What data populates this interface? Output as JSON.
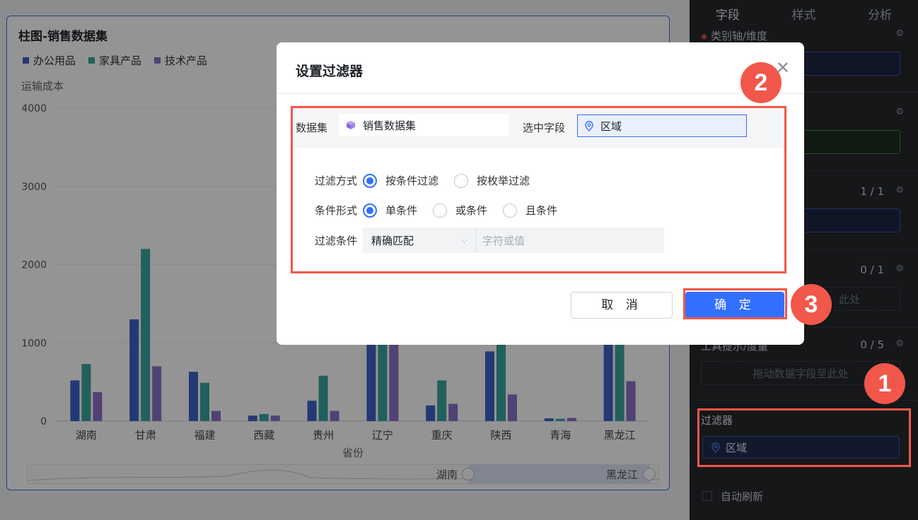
{
  "chart_card": {
    "title": "柱图-销售数据集",
    "y_axis_label": "运输成本",
    "x_axis_label": "省份",
    "slider_start_label": "湖南",
    "slider_end_label": "黑龙江"
  },
  "chart_data": {
    "type": "bar",
    "title": "柱图-销售数据集",
    "xlabel": "省份",
    "ylabel": "运输成本",
    "ylim": [
      0,
      4000
    ],
    "yticks": [
      0,
      1000,
      2000,
      3000,
      4000
    ],
    "categories": [
      "湖南",
      "甘肃",
      "福建",
      "西藏",
      "贵州",
      "辽宁",
      "重庆",
      "陕西",
      "青海",
      "黑龙江"
    ],
    "series": [
      {
        "name": "办公用品",
        "color": "#3e63c8",
        "values": [
          520,
          1300,
          630,
          70,
          260,
          1000,
          200,
          890,
          35,
          1000
        ]
      },
      {
        "name": "家具产品",
        "color": "#3aa6a0",
        "values": [
          730,
          2200,
          490,
          90,
          580,
          1000,
          520,
          1000,
          30,
          1000
        ]
      },
      {
        "name": "技术产品",
        "color": "#8a72c9",
        "values": [
          370,
          700,
          130,
          70,
          130,
          1000,
          220,
          340,
          40,
          510
        ]
      }
    ],
    "legend_position": "top-left",
    "grid": true
  },
  "panel": {
    "tabs": [
      "字段",
      "样式",
      "分析"
    ],
    "active_tab": "字段",
    "category_axis_label": "类别轴/维度",
    "count_a": "1 / 1",
    "count_b": "0 / 1",
    "count_c": "0 / 5",
    "drop_hint_partial": "此处",
    "tooltip_label": "工具提示/度量",
    "drop_hint": "拖动数据字段至此处",
    "filter_label": "过滤器",
    "filter_chip": "区域",
    "auto_refresh": "自动刷新"
  },
  "modal": {
    "title": "设置过滤器",
    "dataset_label": "数据集",
    "dataset_value": "销售数据集",
    "field_label": "选中字段",
    "field_value": "区域",
    "filter_method_label": "过滤方式",
    "filter_method_options": [
      "按条件过滤",
      "按枚举过滤"
    ],
    "filter_method_selected": "按条件过滤",
    "condition_form_label": "条件形式",
    "condition_form_options": [
      "单条件",
      "或条件",
      "且条件"
    ],
    "condition_form_selected": "单条件",
    "condition_label": "过滤条件",
    "condition_select_value": "精确匹配",
    "condition_input_placeholder": "字符或值",
    "cancel_label": "取 消",
    "confirm_label": "确 定"
  },
  "callouts": [
    "1",
    "2",
    "3"
  ],
  "colors": {
    "accent": "#3370ff",
    "highlight": "#f1574a",
    "panel_bg": "#26282c"
  }
}
